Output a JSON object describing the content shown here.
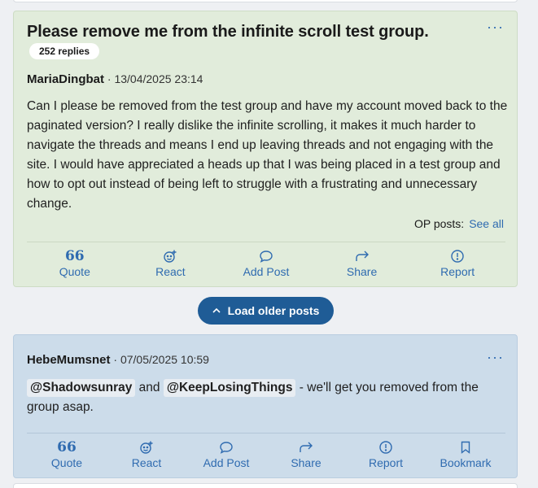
{
  "op_post": {
    "title": "Please remove me from the infinite scroll test group.",
    "replies_badge": "252 replies",
    "author": "MariaDingbat",
    "date": " · 13/04/2025 23:14",
    "body": "Can I please be removed from the test group and have my account moved back to the paginated version? I really dislike the infinite scrolling, it makes it much harder to navigate the threads and means I end up leaving threads and not engaging with the site. I would have appreciated a heads up that I was being placed in a test group and how to opt out instead of being left to struggle with a frustrating and unnecessary change.",
    "op_posts_label": "OP posts:",
    "see_all": "See all",
    "more_glyph": "···",
    "actions": {
      "quote": "Quote",
      "react": "React",
      "add_post": "Add Post",
      "share": "Share",
      "report": "Report"
    }
  },
  "load_older": {
    "label": "Load older posts"
  },
  "reply_post": {
    "author": "HebeMumsnet",
    "date": " · 07/05/2025 10:59",
    "mention_1": "@Shadowsunray",
    "connector": " and ",
    "mention_2": "@KeepLosingThings",
    "body_rest": " - we'll get you removed from the group asap.",
    "more_glyph": "···",
    "actions": {
      "quote": "Quote",
      "react": "React",
      "add_post": "Add Post",
      "share": "Share",
      "report": "Report",
      "bookmark": "Bookmark"
    }
  },
  "icons": {
    "quote": "quote-icon",
    "react": "smiley-plus-icon",
    "add_post": "speech-bubble-icon",
    "share": "share-arrow-icon",
    "report": "exclamation-circle-icon",
    "bookmark": "bookmark-icon",
    "more": "ellipsis-icon",
    "chevron": "chevron-up-icon"
  },
  "colors": {
    "op_background": "#e1ecdb",
    "reply_background": "#ccdcea",
    "link": "#2f6bb0",
    "button": "#1f5c96"
  }
}
